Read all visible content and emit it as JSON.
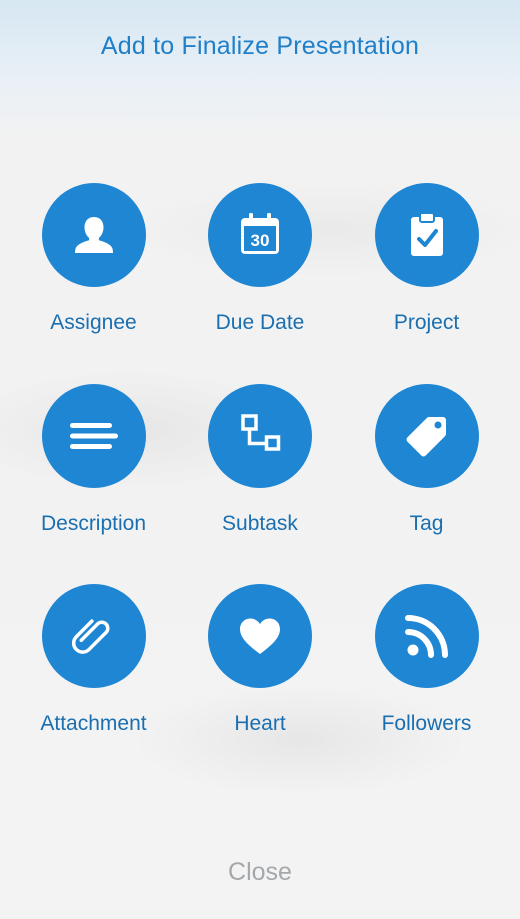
{
  "sheet": {
    "title": "Add to Finalize Presentation",
    "close_label": "Close"
  },
  "actions": [
    {
      "label": "Assignee",
      "icon": "person-icon"
    },
    {
      "label": "Due Date",
      "icon": "calendar-icon",
      "calendar_day": "30"
    },
    {
      "label": "Project",
      "icon": "clipboard-check-icon"
    },
    {
      "label": "Description",
      "icon": "text-lines-icon"
    },
    {
      "label": "Subtask",
      "icon": "subtask-icon"
    },
    {
      "label": "Tag",
      "icon": "tag-icon"
    },
    {
      "label": "Attachment",
      "icon": "paperclip-icon"
    },
    {
      "label": "Heart",
      "icon": "heart-icon"
    },
    {
      "label": "Followers",
      "icon": "rss-icon"
    }
  ],
  "colors": {
    "accent": "#1e86d3",
    "title": "#1f7fc9",
    "label": "#1a6fb0",
    "close": "#a5a8ab"
  }
}
